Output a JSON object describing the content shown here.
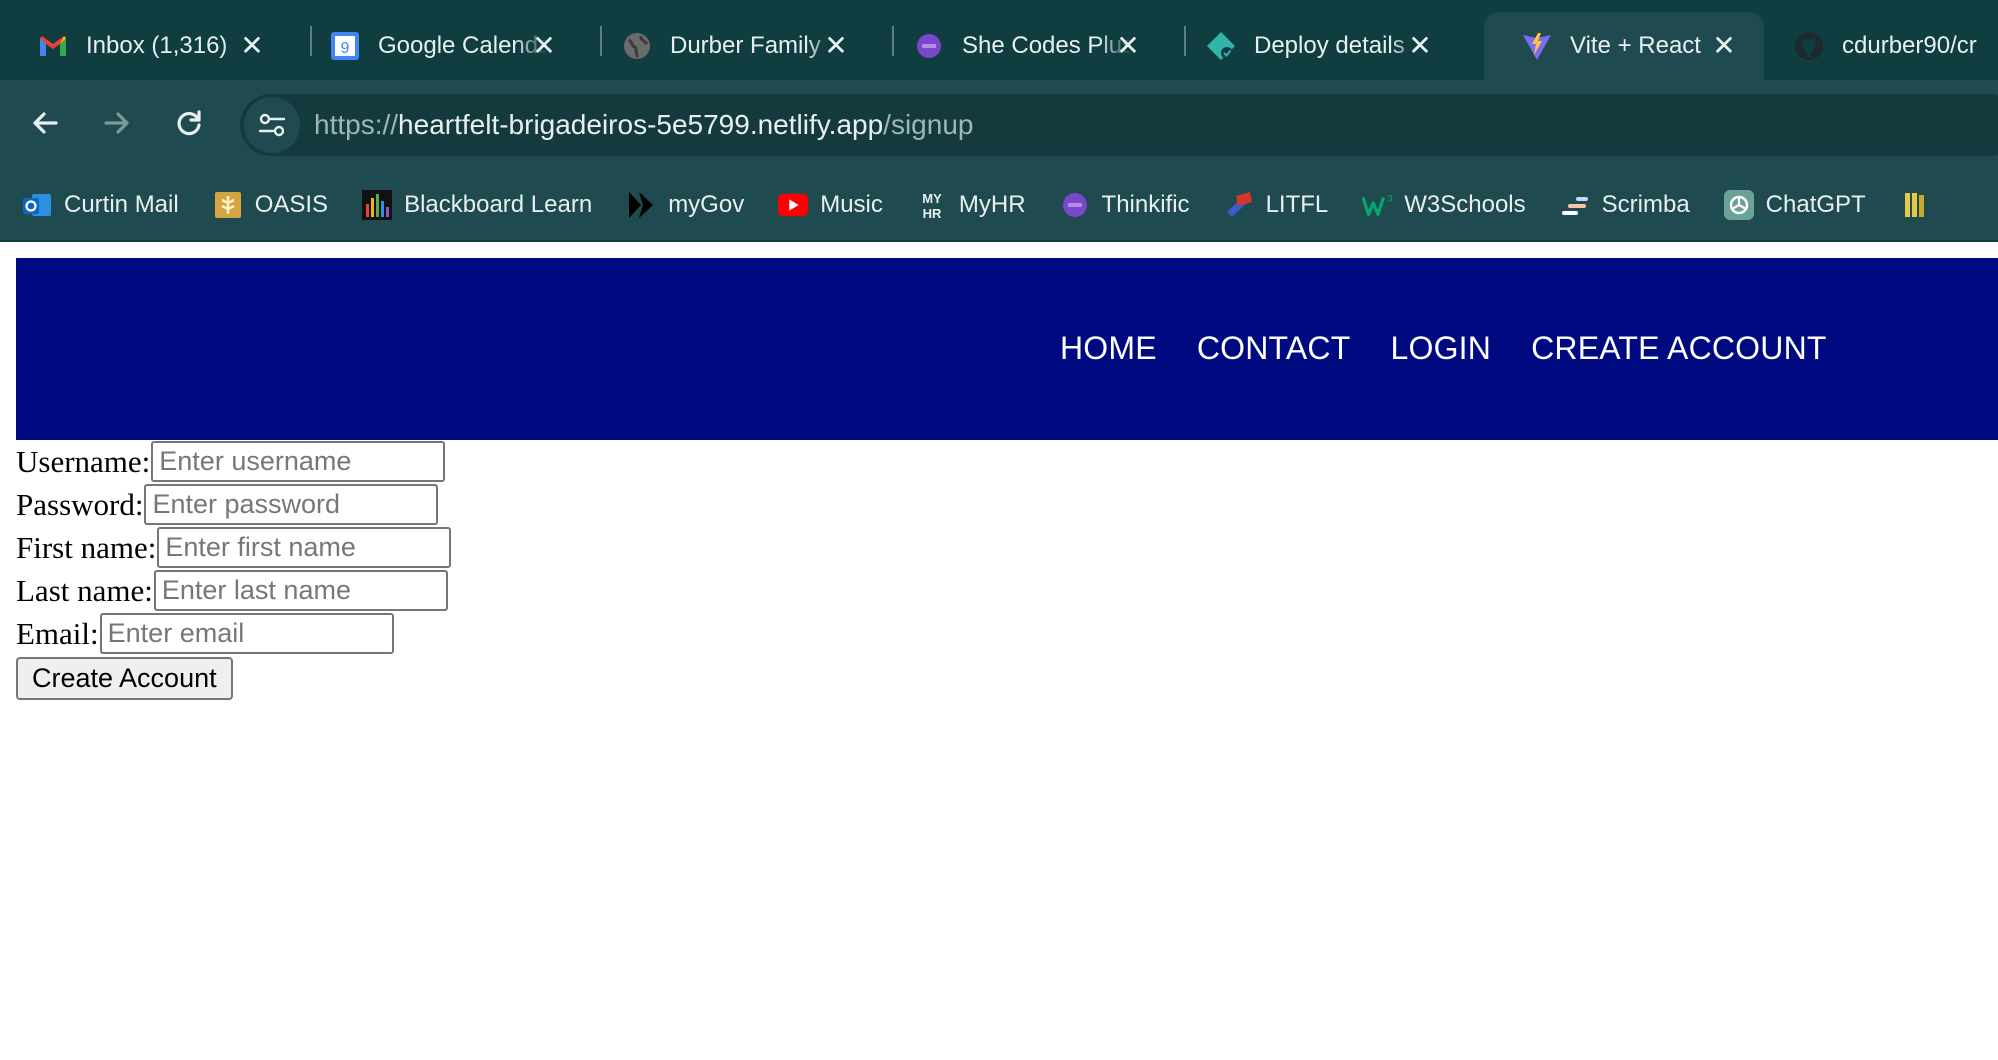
{
  "browser": {
    "tabs": [
      {
        "title": "Inbox (1,316)",
        "icon": "gmail-icon"
      },
      {
        "title": "Google Calendar",
        "icon": "calendar-icon"
      },
      {
        "title": "Durber Family",
        "icon": "globe-icon"
      },
      {
        "title": "She Codes Plus",
        "icon": "shecodes-icon"
      },
      {
        "title": "Deploy details",
        "icon": "netlify-icon"
      },
      {
        "title": "Vite + React",
        "icon": "vite-icon",
        "active": true
      },
      {
        "title": "cdurber90/cr",
        "icon": "github-icon"
      }
    ],
    "calendar_day": "9",
    "close_glyph": "✕",
    "url_scheme": "https://",
    "url_host": "heartfelt-brigadeiros-5e5799.netlify.app",
    "url_path": "/signup",
    "bookmarks": [
      {
        "label": "Curtin Mail",
        "icon": "outlook-icon"
      },
      {
        "label": "OASIS",
        "icon": "oasis-icon"
      },
      {
        "label": "Blackboard Learn",
        "icon": "blackboard-icon"
      },
      {
        "label": "myGov",
        "icon": "mygov-icon"
      },
      {
        "label": "Music",
        "icon": "youtube-music-icon"
      },
      {
        "label": "MyHR",
        "icon": "myhr-icon"
      },
      {
        "label": "Thinkific",
        "icon": "thinkific-icon"
      },
      {
        "label": "LITFL",
        "icon": "litfl-icon"
      },
      {
        "label": "W3Schools",
        "icon": "w3schools-icon"
      },
      {
        "label": "Scrimba",
        "icon": "scrimba-icon"
      },
      {
        "label": "ChatGPT",
        "icon": "chatgpt-icon"
      }
    ],
    "myhr_icon_text": "MY HR"
  },
  "site": {
    "nav": [
      "HOME",
      "CONTACT",
      "LOGIN",
      "CREATE ACCOUNT"
    ],
    "header_color": "#000a80"
  },
  "form": {
    "fields": [
      {
        "label": "Username:",
        "placeholder": "Enter username"
      },
      {
        "label": "Password:",
        "placeholder": "Enter password"
      },
      {
        "label": "First name:",
        "placeholder": "Enter first name"
      },
      {
        "label": "Last name:",
        "placeholder": "Enter last name"
      },
      {
        "label": "Email:",
        "placeholder": "Enter email"
      }
    ],
    "submit_label": "Create Account"
  }
}
